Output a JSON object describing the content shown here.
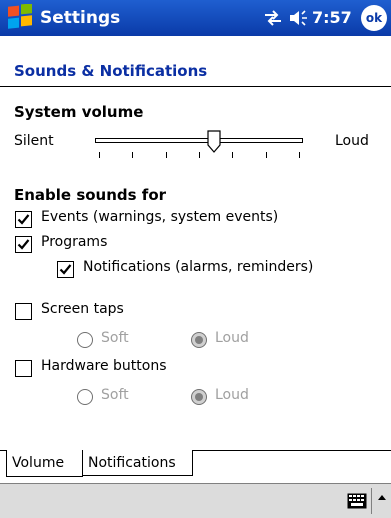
{
  "titlebar": {
    "title": "Settings",
    "time": "7:57",
    "ok_label": "ok"
  },
  "page": {
    "header": "Sounds & Notifications"
  },
  "volume": {
    "section_title": "System volume",
    "min_label": "Silent",
    "max_label": "Loud",
    "level_fraction": 0.57,
    "tick_count": 7
  },
  "enable_sounds": {
    "section_title": "Enable sounds for",
    "events": {
      "label": "Events (warnings, system events)",
      "checked": true
    },
    "programs": {
      "label": "Programs",
      "checked": true
    },
    "notifications": {
      "label": "Notifications (alarms, reminders)",
      "checked": true
    },
    "screen_taps": {
      "label": "Screen taps",
      "checked": false,
      "soft_label": "Soft",
      "loud_label": "Loud",
      "selected": "Loud"
    },
    "hardware_buttons": {
      "label": "Hardware buttons",
      "checked": false,
      "soft_label": "Soft",
      "loud_label": "Loud",
      "selected": "Loud"
    }
  },
  "tabs": [
    {
      "label": "Volume",
      "active": true
    },
    {
      "label": "Notifications",
      "active": false
    }
  ],
  "menubar": {
    "icons": [
      "keyboard-icon",
      "chevron-up-icon"
    ]
  },
  "colors": {
    "titlebar": "#0a3aa8",
    "header_text": "#0b2fa3",
    "menubar": "#dcdcdc",
    "disabled_text": "#a0a0a0"
  }
}
